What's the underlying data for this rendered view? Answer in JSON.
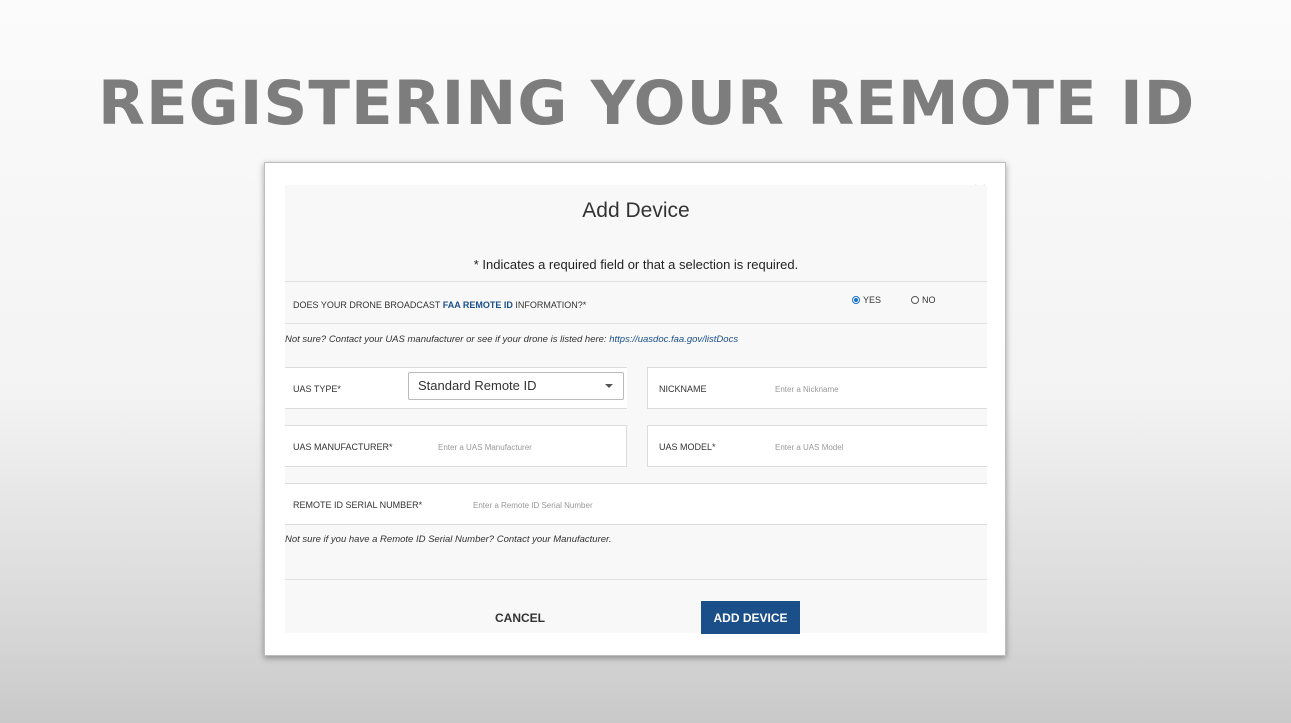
{
  "slide": {
    "title": "REGISTERING YOUR REMOTE ID"
  },
  "dialog": {
    "title": "Add Device",
    "close_glyph": "×",
    "required_note": "* Indicates a required field or that a selection is required.",
    "broadcast_question_prefix": "DOES YOUR DRONE BROADCAST ",
    "broadcast_question_link": "FAA REMOTE ID",
    "broadcast_question_suffix": " INFORMATION?*",
    "broadcast_options": [
      {
        "label": "YES",
        "selected": true
      },
      {
        "label": "NO",
        "selected": false
      }
    ],
    "uas_hint_text": "Not sure? Contact your UAS manufacturer or see if your drone is listed here: ",
    "uas_hint_link": "https://uasdoc.faa.gov/listDocs",
    "uas_type": {
      "label": "UAS TYPE*",
      "value": "Standard Remote ID"
    },
    "nickname": {
      "label": "NICKNAME",
      "placeholder": "Enter a Nickname"
    },
    "manufacturer": {
      "label": "UAS MANUFACTURER*",
      "placeholder": "Enter a UAS Manufacturer"
    },
    "model": {
      "label": "UAS MODEL*",
      "placeholder": "Enter a UAS Model"
    },
    "serial": {
      "label": "REMOTE ID SERIAL NUMBER*",
      "placeholder": "Enter a Remote ID Serial Number"
    },
    "serial_hint": "Not sure if you have a Remote ID Serial Number? Contact your Manufacturer.",
    "cancel_label": "CANCEL",
    "add_label": "ADD DEVICE"
  }
}
